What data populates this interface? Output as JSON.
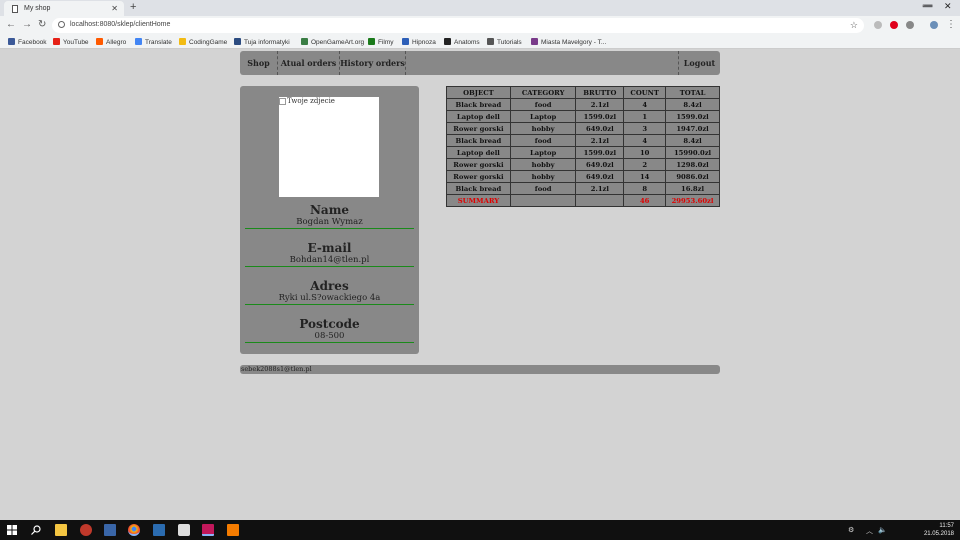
{
  "browser": {
    "tab_title": "My shop",
    "new_tab": "+",
    "url": "localhost:8080/sklep/clientHome",
    "window_controls": {
      "minimize": "➖",
      "close": "✕"
    },
    "bookmarks": [
      {
        "label": "Facebook",
        "color": "#3b5998"
      },
      {
        "label": "YouTube",
        "color": "#e62117"
      },
      {
        "label": "Allegro",
        "color": "#ff5a00"
      },
      {
        "label": "Translate",
        "color": "#4285f4"
      },
      {
        "label": "CodingGame",
        "color": "#f2bb13"
      },
      {
        "label": "Tuja informatyki",
        "color": "#2b4b80"
      },
      {
        "label": "OpenGameArt.org",
        "color": "#3a7d44"
      },
      {
        "label": "Filmy",
        "color": "#1a7a1a"
      },
      {
        "label": "Hipnoza",
        "color": "#2d5fb8"
      },
      {
        "label": "Anatoms",
        "color": "#222222"
      },
      {
        "label": "Tutorials",
        "color": "#555555"
      },
      {
        "label": "Miasta Mavelgory - T...",
        "color": "#7a3b8a"
      }
    ]
  },
  "nav": {
    "shop": "Shop",
    "actual_orders": "Atual orders",
    "history_orders": "History orders",
    "logout": "Logout"
  },
  "profile": {
    "photo_alt": "Twoje zdjecie",
    "name_label": "Name",
    "name_value": "Bogdan Wymaz",
    "email_label": "E-mail",
    "email_value": "Bohdan14@tlen.pl",
    "address_label": "Adres",
    "address_value": "Ryki ul.S?owackiego 4a",
    "postcode_label": "Postcode",
    "postcode_value": "08-500"
  },
  "orders": {
    "headers": [
      "OBJECT",
      "CATEGORY",
      "BRUTTO",
      "COUNT",
      "TOTAL"
    ],
    "rows": [
      [
        "Black bread",
        "food",
        "2.1zl",
        "4",
        "8.4zl"
      ],
      [
        "Laptop dell",
        "Laptop",
        "1599.0zl",
        "1",
        "1599.0zl"
      ],
      [
        "Rower gorski",
        "hobby",
        "649.0zl",
        "3",
        "1947.0zl"
      ],
      [
        "Black bread",
        "food",
        "2.1zl",
        "4",
        "8.4zl"
      ],
      [
        "Laptop dell",
        "Laptop",
        "1599.0zl",
        "10",
        "15990.0zl"
      ],
      [
        "Rower gorski",
        "hobby",
        "649.0zl",
        "2",
        "1298.0zl"
      ],
      [
        "Rower gorski",
        "hobby",
        "649.0zl",
        "14",
        "9086.0zl"
      ],
      [
        "Black bread",
        "food",
        "2.1zl",
        "8",
        "16.8zl"
      ]
    ],
    "summary": [
      "SUMMARY",
      "",
      "",
      "46",
      "29953.60zl"
    ],
    "summary_color": "#e00000"
  },
  "footer": {
    "text": "sebek2088s1@tlen.pl"
  },
  "taskbar": {
    "time": "11:57",
    "date": "21.05.2018",
    "app_icons": [
      "windows-icon",
      "search-icon",
      "file-explorer-icon",
      "media-player-icon",
      "virtualbox-icon",
      "chrome-icon",
      "text-editor-icon",
      "unity-icon",
      "intellij-icon",
      "xampp-icon"
    ]
  }
}
